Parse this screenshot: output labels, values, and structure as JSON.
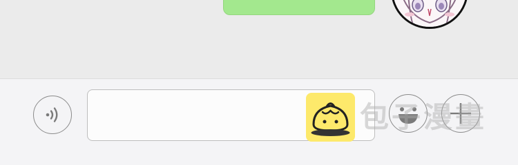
{
  "chat": {
    "message_bubble_text": "",
    "bubble_color": "#a3e88e"
  },
  "input_bar": {
    "voice_icon": "voice-wave-icon",
    "message_input_value": "",
    "emoji_icon": "smile-emoji-icon",
    "plus_icon": "plus-icon"
  },
  "watermark": {
    "text": "包子漫畫",
    "logo_color": "#fde96b"
  }
}
